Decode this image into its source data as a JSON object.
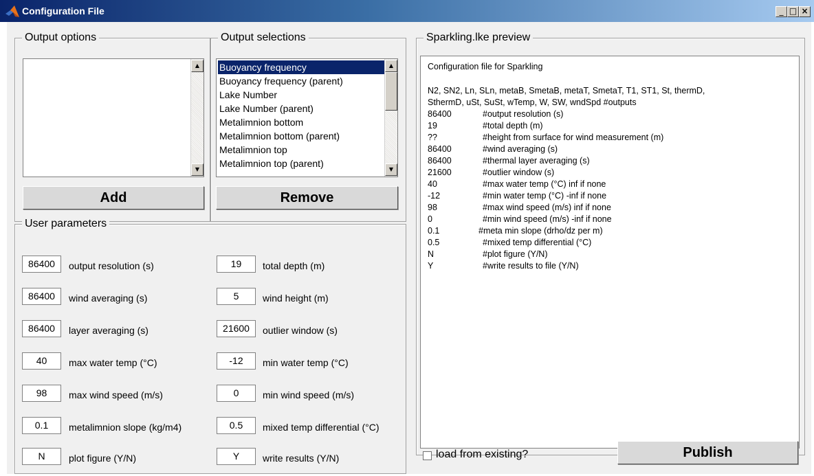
{
  "window": {
    "title": "Configuration File",
    "minimize": "_",
    "maximize": "□",
    "close": "×"
  },
  "output_options": {
    "title": "Output options",
    "items": [],
    "add_label": "Add"
  },
  "output_selections": {
    "title": "Output selections",
    "items": [
      "Buoyancy frequency",
      "Buoyancy frequency (parent)",
      "Lake Number",
      "Lake Number (parent)",
      "Metalimnion bottom",
      "Metalimnion bottom (parent)",
      "Metalimnion top",
      "Metalimnion top (parent)"
    ],
    "selected_index": 0,
    "remove_label": "Remove"
  },
  "user_parameters": {
    "title": "User parameters",
    "params": [
      {
        "value": "86400",
        "label": "output resolution (s)"
      },
      {
        "value": "19",
        "label": "total depth (m)"
      },
      {
        "value": "86400",
        "label": "wind averaging (s)"
      },
      {
        "value": "5",
        "label": "wind height (m)"
      },
      {
        "value": "86400",
        "label": "layer averaging (s)"
      },
      {
        "value": "21600",
        "label": "outlier window (s)"
      },
      {
        "value": "40",
        "label": "max water temp (°C)"
      },
      {
        "value": "-12",
        "label": "min water temp (°C)"
      },
      {
        "value": "98",
        "label": "max wind speed (m/s)"
      },
      {
        "value": "0",
        "label": "min wind speed (m/s)"
      },
      {
        "value": "0.1",
        "label": "metalimnion slope (kg/m4)"
      },
      {
        "value": "0.5",
        "label": "mixed temp differential (°C)"
      },
      {
        "value": "N",
        "label": "plot figure (Y/N)"
      },
      {
        "value": "Y",
        "label": "write results (Y/N)"
      }
    ]
  },
  "preview": {
    "title": "Sparkling.lke preview",
    "header": "Configuration file for Sparkling",
    "outputs_line1": "N2, SN2, Ln, SLn, metaB, SmetaB, metaT, SmetaT, T1, ST1, St, thermD,",
    "outputs_line2": "SthermD, uSt, SuSt, wTemp, W, SW, wndSpd        #outputs",
    "rows": [
      {
        "value": "86400",
        "comment": "#output resolution (s)"
      },
      {
        "value": "19",
        "comment": "#total depth (m)"
      },
      {
        "value": "??",
        "comment": "#height from surface for wind measurement (m)"
      },
      {
        "value": "86400",
        "comment": "#wind averaging (s)"
      },
      {
        "value": "86400",
        "comment": "#thermal layer averaging (s)"
      },
      {
        "value": "21600",
        "comment": "#outlier window (s)"
      },
      {
        "value": "40",
        "comment": "#max water temp (°C)    inf if none"
      },
      {
        "value": "-12",
        "comment": "#min water temp (°C)   -inf if none"
      },
      {
        "value": "98",
        "comment": "#max wind speed (m/s)   inf if none"
      },
      {
        "value": "0",
        "comment": "#min wind speed (m/s)   -inf if none"
      },
      {
        "value": "0.1",
        "comment": "#meta min slope (drho/dz per m)"
      },
      {
        "value": "0.5",
        "comment": "#mixed temp differential (°C)"
      },
      {
        "value": "N",
        "comment": "#plot figure (Y/N)"
      },
      {
        "value": "Y",
        "comment": "#write results to file (Y/N)"
      }
    ]
  },
  "load_existing": {
    "label": "load from existing?",
    "checked": false
  },
  "publish_label": "Publish"
}
